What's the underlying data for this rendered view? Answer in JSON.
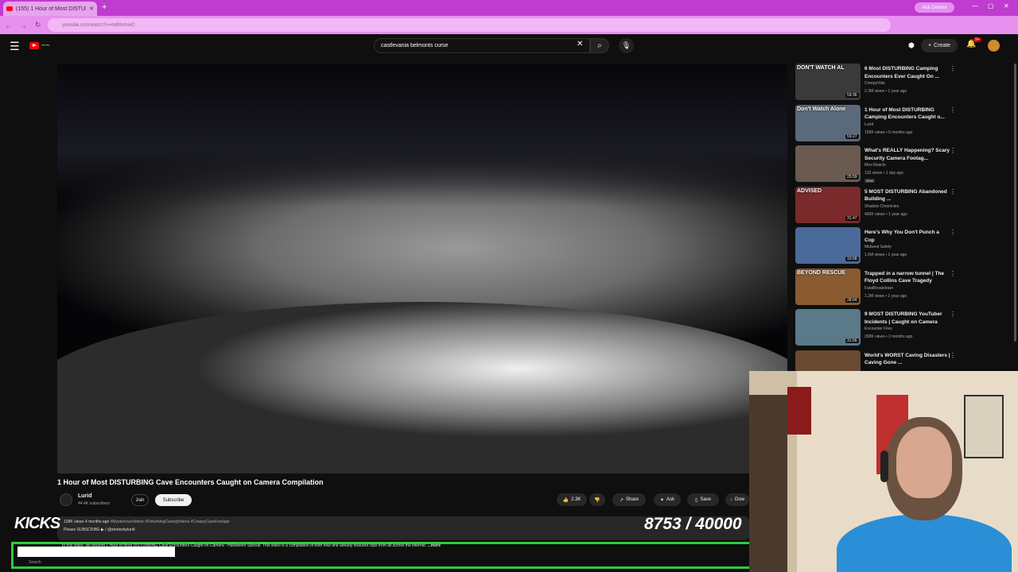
{
  "browser": {
    "tab_title": "(155) 1 Hour of Most DISTUR...",
    "new_tab": "+",
    "ask_gemini": "Ask Gemini",
    "url": "youtube.com/watch?v=m8fdvtswO"
  },
  "youtube": {
    "search_query": "castlevania belmonts curse",
    "create_label": "Create",
    "notification_count": "9+"
  },
  "video": {
    "title": "1 Hour of Most DISTURBING Cave Encounters Caught on Camera Compilation",
    "channel": "Lurid",
    "subscribers": "44.4K subscribers",
    "join_label": "Join",
    "subscribe_label": "Subscribe",
    "likes": "2.3K",
    "share_label": "Share",
    "ask_label": "Ask",
    "save_label": "Save",
    "download_label": "Dow"
  },
  "description": {
    "meta": "128K views  4 months ago",
    "tags": "#MysteriousVideos #DisturbingCavingVideos #CreepyCaveFootage",
    "subscribe_line": "Please SUBSCRIBE ▶ / @storiesbylurid",
    "text": "In this video, we present 1 Hour of Most DISTURBING Cave Encounters Caught on Camera - Halloween Special. This video is a compilation of both new and already featured clips from all across the internet.",
    "more": "...more"
  },
  "overlay": {
    "kicks": "KICKS",
    "counter": "8753  / 40000"
  },
  "taskbar": {
    "search": "Search"
  },
  "recommendations": [
    {
      "title": "6 Most DISTURBING Camping Encounters Ever Caught On ...",
      "channel": "CreepyVids",
      "meta": "2.3M views • 1 year ago",
      "duration": "59:36",
      "overlay": "DON'T WATCH AL",
      "thumb": "#3a3a3a"
    },
    {
      "title": "1 Hour of Most DISTURBING Camping Encounters Caught o...",
      "channel": "Lurid",
      "meta": "156K views • 5 months ago",
      "duration": "59:27",
      "overlay": "Don't Watch Alone",
      "thumb": "#5a6a7a"
    },
    {
      "title": "What's REALLY Happening? Scary Security Camera Footag...",
      "channel": "Moo Reacts",
      "meta": "132 views • 1 day ago",
      "duration": "25:59",
      "overlay": "",
      "badge": "New",
      "thumb": "#6a5a50"
    },
    {
      "title": "5 MOST DISTURBING Abandoned Building ...",
      "channel": "Shadow Chronicles",
      "meta": "490K views • 1 year ago",
      "duration": "31:47",
      "overlay": "ADVISED",
      "thumb": "#7a2a2a"
    },
    {
      "title": "Here's Why You Don't Punch a Cop",
      "channel": "Midwest Safety",
      "meta": "1.6M views • 1 year ago",
      "duration": "19:58",
      "overlay": "",
      "thumb": "#4a6a9a"
    },
    {
      "title": "Trapped in a narrow tunnel | The Floyd Collins Cave Tragedy",
      "channel": "FatalBreakdown",
      "meta": "1.2M views • 1 year ago",
      "duration": "28:04",
      "overlay": "BEYOND RESCUE",
      "thumb": "#8a5a30"
    },
    {
      "title": "9 MOST DISTURBING YouTuber Incidents | Caught on Camera",
      "channel": "Encounter Files",
      "meta": "268K views • 2 months ago",
      "duration": "31:56",
      "overlay": "",
      "thumb": "#5a7a8a"
    },
    {
      "title": "World's WORST Caving Disasters | Caving Gone ...",
      "channel": "",
      "meta": "",
      "duration": "",
      "overlay": "",
      "thumb": "#6a4a30"
    }
  ]
}
